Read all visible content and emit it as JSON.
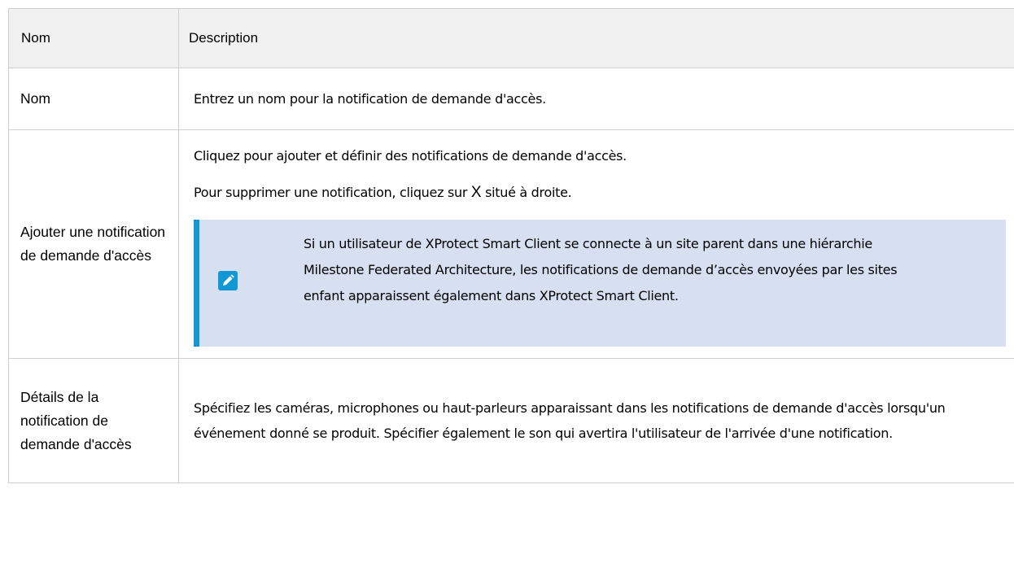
{
  "table": {
    "headers": {
      "name": "Nom",
      "description": "Description"
    },
    "rows": [
      {
        "name": "Nom",
        "description": "Entrez un nom pour la notification de demande d'accès."
      },
      {
        "name": "Ajouter une notification de demande d'accès",
        "description_1": "Cliquez pour ajouter et définir des notifications de demande d'accès.",
        "description_2_before": "Pour supprimer une notification, cliquez sur ",
        "description_2_mark": "X",
        "description_2_after": " situé à droite.",
        "note": {
          "icon": "pencil-icon",
          "text": "Si un utilisateur de XProtect Smart Client se connecte à un site parent dans une hiérarchie Milestone Federated Architecture, les notifications de demande d’accès envoyées par les sites enfant apparaissent également dans XProtect Smart Client."
        }
      },
      {
        "name": "Détails de la notification de demande d'accès",
        "description": "Spécifiez les caméras, microphones ou haut-parleurs apparaissant dans les notifications de demande d'accès lorsqu'un événement donné se produit. Spécifier également le son qui avertira l'utilisateur de l'arrivée d'une notification."
      }
    ]
  },
  "colors": {
    "header_bg": "#f1f1f1",
    "border": "#cfcfcf",
    "note_bg": "#d6e0f0",
    "note_accent": "#1197d5"
  }
}
